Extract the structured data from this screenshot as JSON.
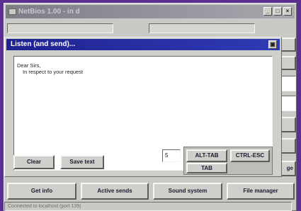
{
  "main": {
    "title": "NetBios 1.00 - in d",
    "bottom_buttons": [
      "Get info",
      "Active sends",
      "Sound system",
      "File manager"
    ],
    "right_button_partial_label": "ge",
    "status": "Connected to localhost (port 139)"
  },
  "dialog": {
    "title": "Listen (and send)...",
    "lines": [
      "Dear Sirs,",
      "In respect to your request"
    ],
    "clear_label": "Clear",
    "save_label": "Save text",
    "key_field_value": "5",
    "alt_tab_label": "ALT-TAB",
    "ctrl_esc_label": "CTRL-ESC",
    "tab_label": "TAB"
  }
}
